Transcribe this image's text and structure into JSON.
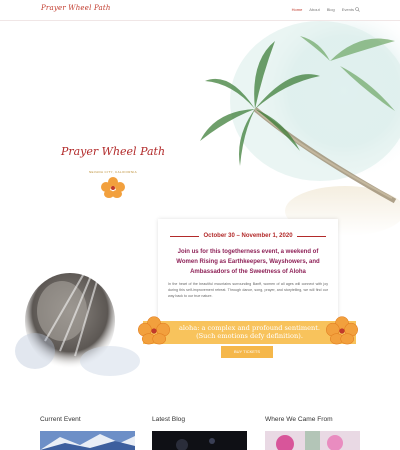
{
  "header": {
    "logo_text": "Prayer Wheel Path",
    "nav": [
      "Home",
      "About",
      "Blog",
      "Events"
    ]
  },
  "hero": {
    "emblem_title": "Prayer Wheel Path",
    "emblem_subtitle": "NEVADA CITY, CALIFORNIA",
    "date": "October 30 – November 1, 2020",
    "headline": "Join us for this togetherness event, a weekend of Women Rising as Earthkeepers, Wayshowers, and Ambassadors of the Sweetness of Aloha",
    "body": "In the heart of the beautiful mountains surrounding Banff, women of all ages will connect with joy during this self-improvement retreat. Through dance, song, prayer, and storytelling, we will find our way back to our true nature.",
    "aloha_line1": "aloha: a complex and profound sentiment.",
    "aloha_line2": "(Such emotions defy definition).",
    "buy_label": "BUY TICKETS"
  },
  "sections": [
    {
      "title": "Current Event"
    },
    {
      "title": "Latest Blog"
    },
    {
      "title": "Where We Came From"
    }
  ],
  "colors": {
    "brand_red": "#b22a2a",
    "plum": "#8e2157",
    "gold": "#f7be4e",
    "hibiscus": "#f2a03d"
  }
}
